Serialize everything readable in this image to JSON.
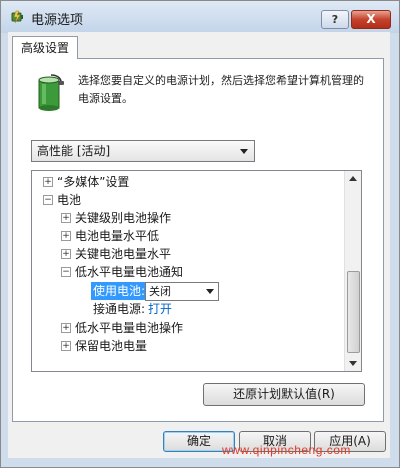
{
  "window": {
    "title": "电源选项",
    "help_label": "?",
    "close_label": "X"
  },
  "tab": {
    "label": "高级设置"
  },
  "intro_text": "选择您要自定义的电源计划，然后选择您希望计算机管理的电源设置。",
  "plan_select": {
    "value": "高性能 [活动]"
  },
  "tree": {
    "items": [
      {
        "expander": "+",
        "label": "“多媒体”设置"
      },
      {
        "expander": "−",
        "label": "电池"
      },
      {
        "expander": "+",
        "label": "关键级别电池操作"
      },
      {
        "expander": "+",
        "label": "电池电量水平低"
      },
      {
        "expander": "+",
        "label": "关键电池电量水平"
      },
      {
        "expander": "−",
        "label": "低水平电量电池通知"
      },
      {
        "expander": "+",
        "label": "低水平电量电池操作"
      },
      {
        "expander": "+",
        "label": "保留电池电量"
      }
    ],
    "on_battery_label": "使用电池:",
    "on_battery_value": "关闭",
    "plugged_in_label": "接通电源:",
    "plugged_in_value": "打开"
  },
  "buttons": {
    "restore": "还原计划默认值(R)",
    "ok": "确定",
    "cancel": "取消",
    "apply": "应用(A)"
  },
  "watermark": "www.qinpincheng.com",
  "colors": {
    "selection": "#3399ff",
    "link_value": "#0066cc",
    "watermark": "#e23a2a"
  }
}
